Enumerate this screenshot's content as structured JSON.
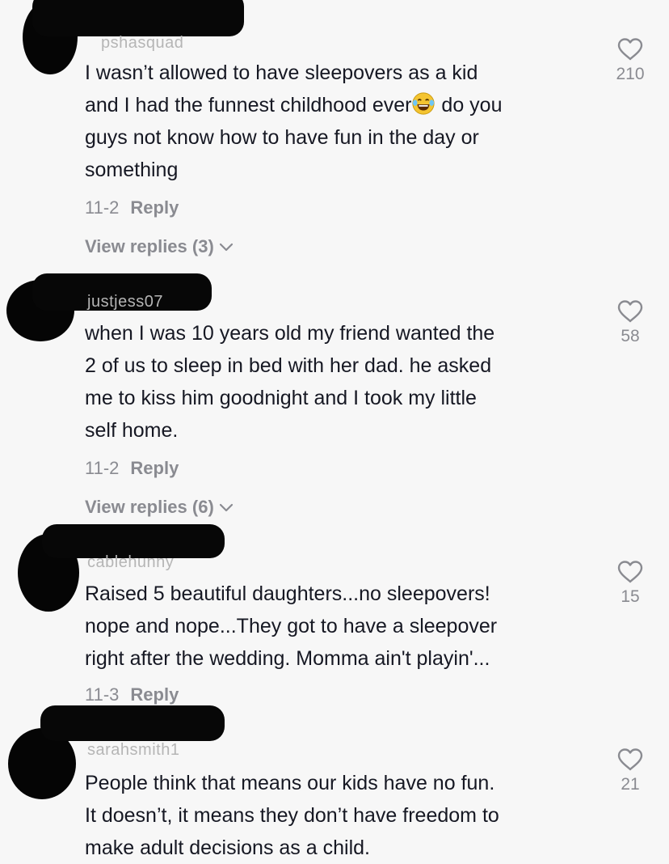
{
  "comments": [
    {
      "username": "pshasquad",
      "lines": [
        "I wasn’t allowed to have sleepovers as a kid",
        "and I had the funnest childhood ever",
        "guys not know how to have fun in the day or",
        "something"
      ],
      "line2_after_emoji": " do you",
      "emoji": "face-with-tears-of-joy",
      "date": "11-2",
      "reply_label": "Reply",
      "view_replies": "View replies (3)",
      "likes": "210"
    },
    {
      "username": "justjess07",
      "lines": [
        "when I was 10 years old my friend wanted the",
        "2 of us to sleep in bed with her dad. he asked",
        "me to kiss him goodnight and I took my little",
        "self home."
      ],
      "date": "11-2",
      "reply_label": "Reply",
      "view_replies": "View replies (6)",
      "likes": "58"
    },
    {
      "username": "cablehunny",
      "lines": [
        "Raised 5 beautiful daughters...no sleepovers!",
        "nope and nope...They got to have a sleepover",
        "right after the wedding. Momma ain't playin'..."
      ],
      "date": "11-3",
      "reply_label": "Reply",
      "likes": "15"
    },
    {
      "username": "sarahsmith1",
      "lines": [
        "People think that means our kids have no fun.",
        "It doesn’t, it means they don’t have freedom to",
        "make adult decisions as a child."
      ],
      "likes": "21"
    }
  ],
  "icons": {
    "like": "heart-outline-icon",
    "expand": "chevron-down-icon"
  },
  "colors": {
    "background": "#f7f7f7",
    "text": "#161823",
    "muted": "#8a8b91",
    "redaction": "#070707"
  }
}
